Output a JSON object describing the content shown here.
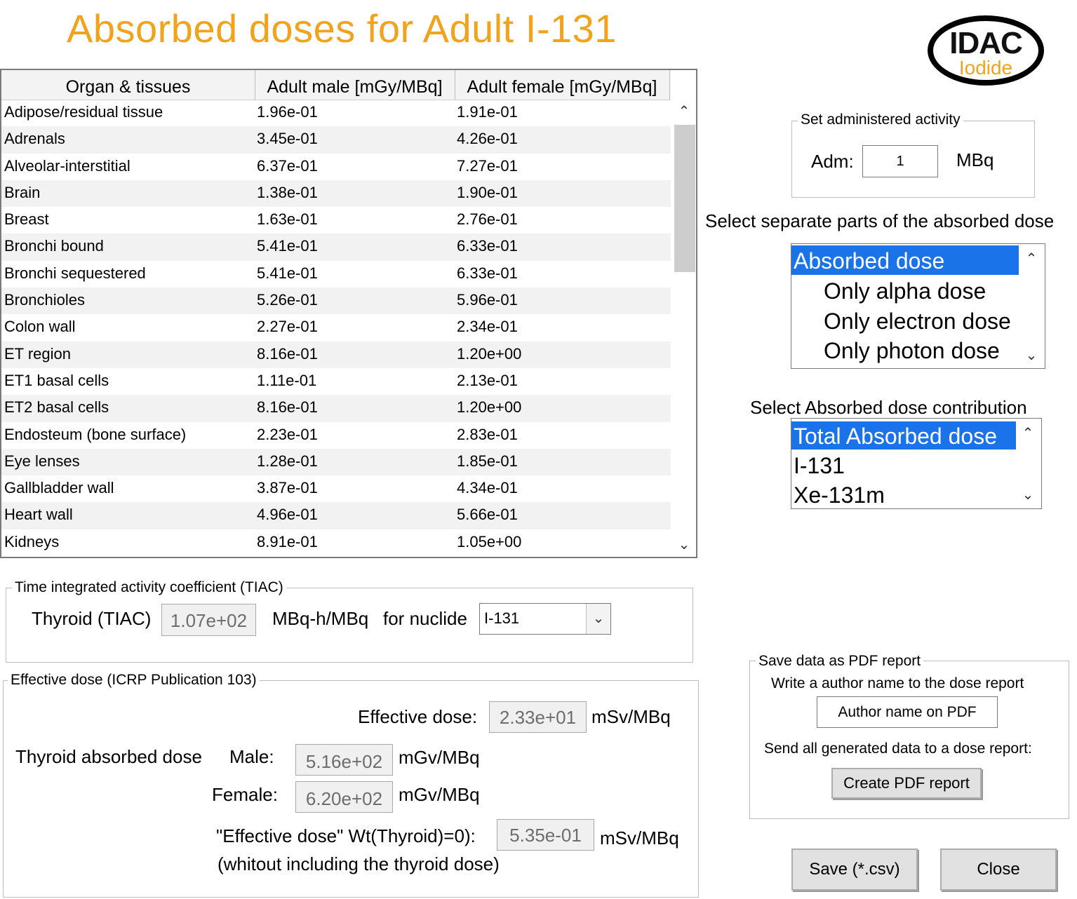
{
  "title": "Absorbed doses for Adult I-131",
  "logo": {
    "main": "IDAC",
    "sub": "Iodide"
  },
  "table": {
    "headers": [
      "Organ & tissues",
      "Adult male [mGy/MBq]",
      "Adult female [mGy/MBq]"
    ],
    "rows": [
      [
        "Adipose/residual tissue",
        "1.96e-01",
        "1.91e-01"
      ],
      [
        "Adrenals",
        "3.45e-01",
        "4.26e-01"
      ],
      [
        "Alveolar-interstitial",
        "6.37e-01",
        "7.27e-01"
      ],
      [
        "Brain",
        "1.38e-01",
        "1.90e-01"
      ],
      [
        "Breast",
        "1.63e-01",
        "2.76e-01"
      ],
      [
        "Bronchi bound",
        "5.41e-01",
        "6.33e-01"
      ],
      [
        "Bronchi sequestered",
        "5.41e-01",
        "6.33e-01"
      ],
      [
        "Bronchioles",
        "5.26e-01",
        "5.96e-01"
      ],
      [
        "Colon wall",
        "2.27e-01",
        "2.34e-01"
      ],
      [
        "ET region",
        "8.16e-01",
        "1.20e+00"
      ],
      [
        "ET1 basal cells",
        "1.11e-01",
        "2.13e-01"
      ],
      [
        "ET2 basal cells",
        "8.16e-01",
        "1.20e+00"
      ],
      [
        "Endosteum (bone surface)",
        "2.23e-01",
        "2.83e-01"
      ],
      [
        "Eye lenses",
        "1.28e-01",
        "1.85e-01"
      ],
      [
        "Gallbladder wall",
        "3.87e-01",
        "4.34e-01"
      ],
      [
        "Heart wall",
        "4.96e-01",
        "5.66e-01"
      ],
      [
        "Kidneys",
        "8.91e-01",
        "1.05e+00"
      ]
    ]
  },
  "activity": {
    "legend": "Set administered activity",
    "label": "Adm:",
    "value": "1",
    "unit": "MBq"
  },
  "dose_parts": {
    "heading": "Select separate parts of the absorbed dose",
    "items": [
      "Absorbed dose",
      "Only alpha dose",
      "Only electron dose",
      "Only photon dose"
    ]
  },
  "contribution": {
    "heading": "Select Absorbed dose contribution",
    "items": [
      "Total Absorbed dose",
      "I-131",
      "Xe-131m"
    ]
  },
  "tiac": {
    "legend": "Time integrated activity coefficient (TIAC)",
    "label": "Thyroid (TIAC)",
    "value": "1.07e+02",
    "unit": "MBq-h/MBq",
    "nuclide_label": "for nuclide",
    "nuclide_value": "I-131"
  },
  "effective": {
    "legend": "Effective dose (ICRP Publication 103)",
    "effective_label": "Effective dose:",
    "effective_value": "2.33e+01",
    "effective_unit": "mSv/MBq",
    "thyroid_label": "Thyroid absorbed dose",
    "male_label": "Male:",
    "male_value": "5.16e+02",
    "male_unit": "mGv/MBq",
    "female_label": "Female:",
    "female_value": "6.20e+02",
    "female_unit": "mGv/MBq",
    "wt_label": "\"Effective dose\" Wt(Thyroid)=0):",
    "wt_value": "5.35e-01",
    "wt_unit": "mSv/MBq",
    "note": "(whitout including the thyroid dose)"
  },
  "pdf": {
    "legend": "Save data as PDF report",
    "author_prompt": "Write a author name to the dose report",
    "author_placeholder": "Author name on PDF",
    "send_label": "Send all generated data to a dose report:",
    "create_button": "Create PDF report"
  },
  "buttons": {
    "save": "Save (*.csv)",
    "close": "Close"
  },
  "colors": {
    "title": "#f2a31b",
    "selection": "#1a73e8"
  }
}
